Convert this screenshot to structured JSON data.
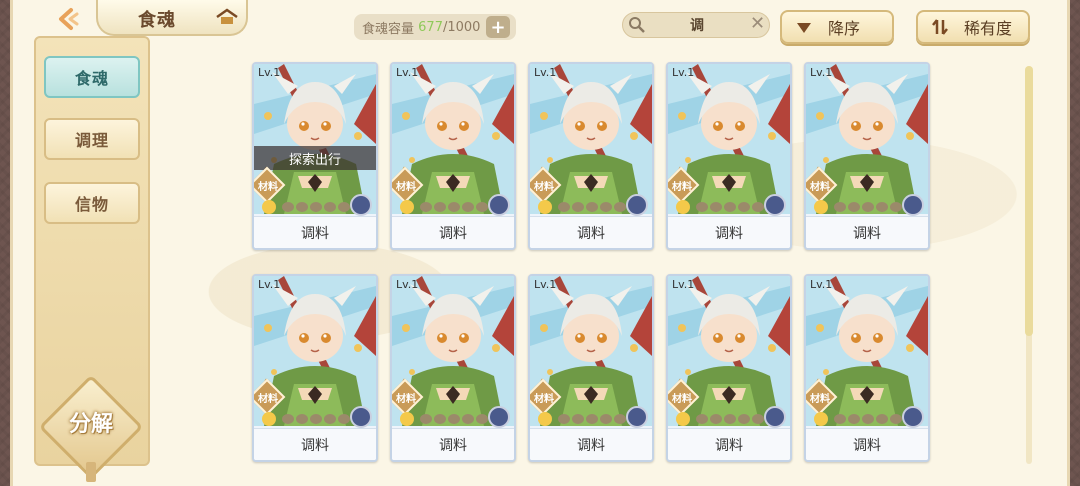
{
  "header": {
    "title": "食魂",
    "capacity_label": "食魂容量",
    "capacity_current": "677",
    "capacity_max": "/1000",
    "search_value": "调",
    "sort_order_label": "降序",
    "sort_key_label": "稀有度"
  },
  "sidebar": {
    "items": [
      {
        "label": "食魂",
        "active": true
      },
      {
        "label": "调理",
        "active": false
      },
      {
        "label": "信物",
        "active": false
      }
    ],
    "decompose_label": "分解"
  },
  "cards": [
    {
      "level": "Lv.1",
      "name": "调料",
      "tag": "材料",
      "status": "探索出行"
    },
    {
      "level": "Lv.1",
      "name": "调料",
      "tag": "材料",
      "status": ""
    },
    {
      "level": "Lv.1",
      "name": "调料",
      "tag": "材料",
      "status": ""
    },
    {
      "level": "Lv.1",
      "name": "调料",
      "tag": "材料",
      "status": ""
    },
    {
      "level": "Lv.1",
      "name": "调料",
      "tag": "材料",
      "status": ""
    },
    {
      "level": "Lv.1",
      "name": "调料",
      "tag": "材料",
      "status": ""
    },
    {
      "level": "Lv.1",
      "name": "调料",
      "tag": "材料",
      "status": ""
    },
    {
      "level": "Lv.1",
      "name": "调料",
      "tag": "材料",
      "status": ""
    },
    {
      "level": "Lv.1",
      "name": "调料",
      "tag": "材料",
      "status": ""
    },
    {
      "level": "Lv.1",
      "name": "调料",
      "tag": "材料",
      "status": ""
    }
  ],
  "colors": {
    "accent_teal": "#7fc6c2",
    "panel_bg": "#fbf6e6",
    "capacity_current": "#8fc95a"
  },
  "icons": [
    "back-arrow-icon",
    "home-icon",
    "add-icon",
    "search-icon",
    "clear-icon",
    "sort-desc-icon",
    "sort-rarity-icon",
    "element-icon",
    "bell-icon"
  ]
}
